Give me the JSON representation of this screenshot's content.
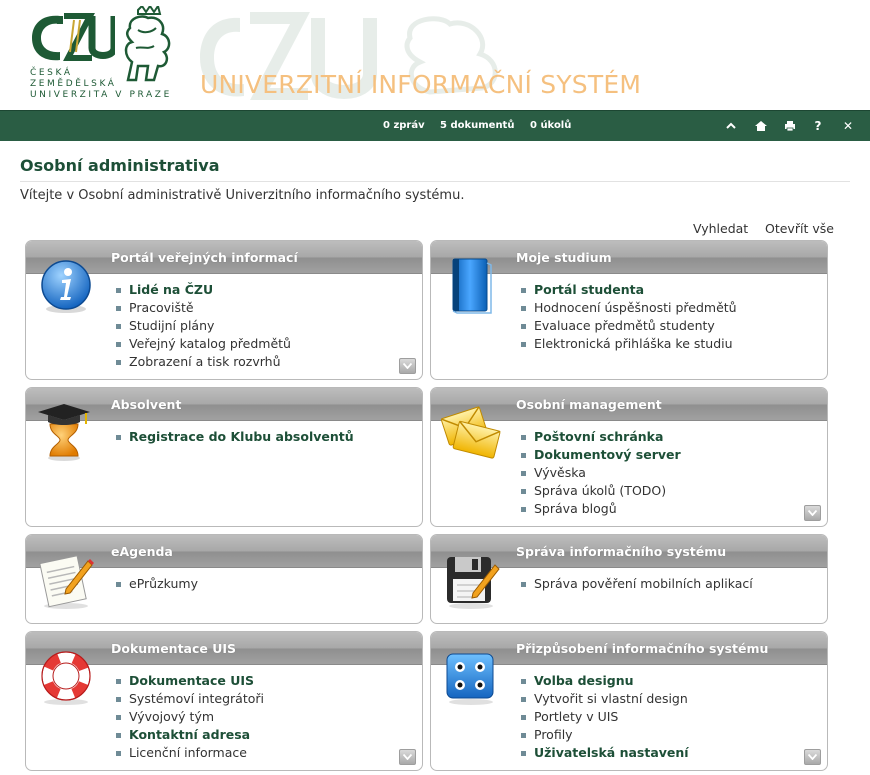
{
  "header": {
    "logo_text": [
      "ČESKÁ",
      "ZEMĚDĚLSKÁ",
      "UNIVERZITA V PRAZE"
    ],
    "system_title": "UNIVERZITNÍ INFORMAČNÍ SYSTÉM"
  },
  "topbar": {
    "messages": "0 zpráv",
    "documents": "5 dokumentů",
    "tasks": "0 úkolů",
    "tools": [
      "up-arrow-icon",
      "home-icon",
      "print-icon",
      "help-icon",
      "close-icon"
    ],
    "help_symbol": "?",
    "close_symbol": "✕"
  },
  "page": {
    "title": "Osobní administrativa",
    "welcome": "Vítejte v Osobní administrativě Univerzitního informačního systému.",
    "search_link": "Vyhledat",
    "open_all_link": "Otevřít vše"
  },
  "panels": [
    {
      "title": "Portál veřejných informací",
      "icon": "info-icon",
      "items": [
        {
          "label": "Lidé na ČZU",
          "strong": true
        },
        {
          "label": "Pracoviště",
          "strong": false
        },
        {
          "label": "Studijní plány",
          "strong": false
        },
        {
          "label": "Veřejný katalog předmětů",
          "strong": false
        },
        {
          "label": "Zobrazení a tisk rozvrhů",
          "strong": false
        }
      ],
      "expandable": true
    },
    {
      "title": "Moje studium",
      "icon": "blue-book-icon",
      "items": [
        {
          "label": "Portál studenta",
          "strong": true
        },
        {
          "label": "Hodnocení úspěšnosti předmětů",
          "strong": false
        },
        {
          "label": "Evaluace předmětů studenty",
          "strong": false
        },
        {
          "label": "Elektronická přihláška ke studiu",
          "strong": false
        }
      ],
      "expandable": false
    },
    {
      "title": "Absolvent",
      "icon": "graduate-icon",
      "items": [
        {
          "label": "Registrace do Klubu absolventů",
          "strong": true
        }
      ],
      "expandable": false
    },
    {
      "title": "Osobní management",
      "icon": "envelopes-icon",
      "items": [
        {
          "label": "Poštovní schránka",
          "strong": true
        },
        {
          "label": "Dokumentový server",
          "strong": true
        },
        {
          "label": "Vývěska",
          "strong": false
        },
        {
          "label": "Správa úkolů (TODO)",
          "strong": false
        },
        {
          "label": "Správa blogů",
          "strong": false
        }
      ],
      "expandable": true
    },
    {
      "title": "eAgenda",
      "icon": "notepad-icon",
      "items": [
        {
          "label": "ePrůzkumy",
          "strong": false
        }
      ],
      "expandable": false
    },
    {
      "title": "Správa informačního systému",
      "icon": "floppy-disk-icon",
      "items": [
        {
          "label": "Správa pověření mobilních aplikací",
          "strong": false
        }
      ],
      "expandable": false
    },
    {
      "title": "Dokumentace UIS",
      "icon": "lifebuoy-icon",
      "items": [
        {
          "label": "Dokumentace UIS",
          "strong": true
        },
        {
          "label": "Systémoví integrátoři",
          "strong": false
        },
        {
          "label": "Vývojový tým",
          "strong": false
        },
        {
          "label": "Kontaktní adresa",
          "strong": true
        },
        {
          "label": "Licenční informace",
          "strong": false
        }
      ],
      "expandable": true
    },
    {
      "title": "Přizpůsobení informačního systému",
      "icon": "customize-icon",
      "items": [
        {
          "label": "Volba designu",
          "strong": true
        },
        {
          "label": "Vytvořit si vlastní design",
          "strong": false
        },
        {
          "label": "Portlety v UIS",
          "strong": false
        },
        {
          "label": "Profily",
          "strong": false
        },
        {
          "label": "Uživatelská nastavení",
          "strong": true
        }
      ],
      "expandable": true
    }
  ]
}
